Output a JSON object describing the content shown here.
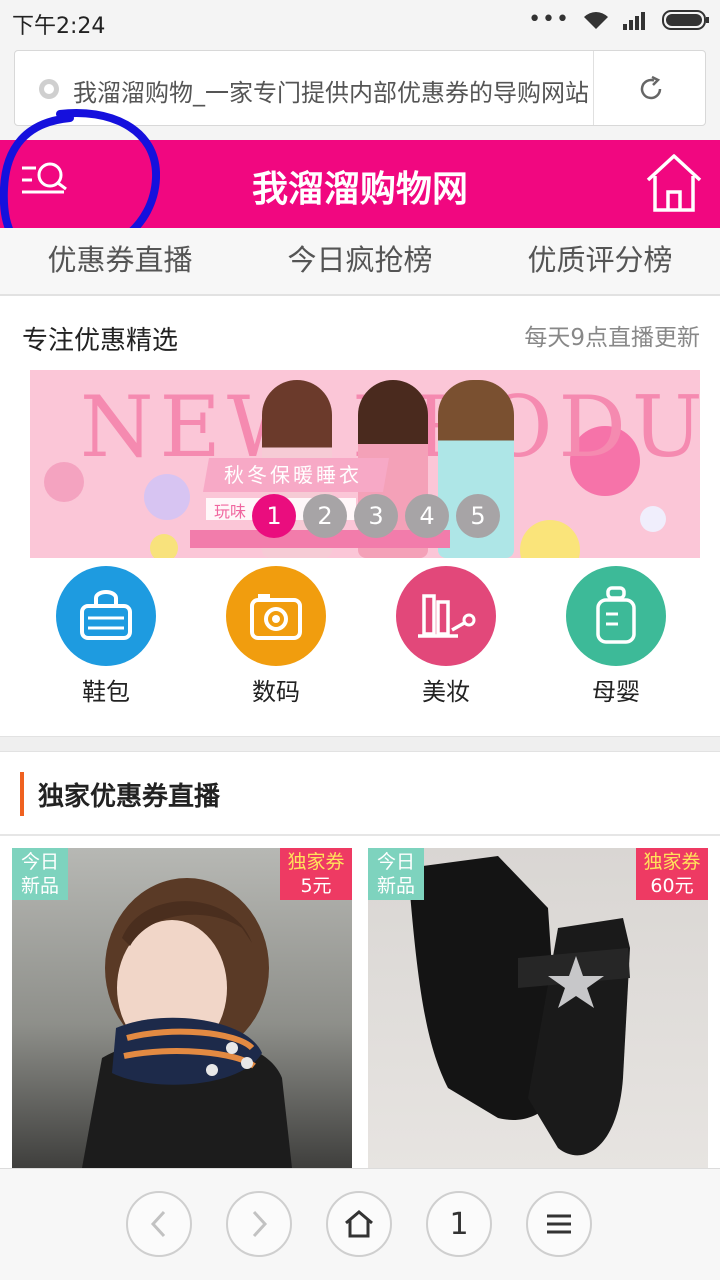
{
  "status_bar": {
    "time": "下午2:24",
    "more": "•••"
  },
  "address_bar": {
    "text": "我溜溜购物_一家专门提供内部优惠券的导购网站"
  },
  "header": {
    "title": "我溜溜购物网",
    "brand_color": "#f10780"
  },
  "tabs": [
    {
      "label": "优惠券直播"
    },
    {
      "label": "今日疯抢榜"
    },
    {
      "label": "优质评分榜"
    }
  ],
  "section": {
    "title": "专注优惠精选",
    "subtitle": "每天9点直播更新"
  },
  "banner": {
    "headline": "NEW PRODUCT",
    "caption": "秋冬保暖睡衣",
    "caption2": "玩味",
    "pager": [
      "1",
      "2",
      "3",
      "4",
      "5"
    ],
    "active_page": 1
  },
  "categories": [
    {
      "label": "鞋包",
      "icon": "basket-icon",
      "color": "#1e9be0"
    },
    {
      "label": "数码",
      "icon": "camera-icon",
      "color": "#f19d0e"
    },
    {
      "label": "美妆",
      "icon": "cosmetics-icon",
      "color": "#e2487a"
    },
    {
      "label": "母婴",
      "icon": "baby-bottle-icon",
      "color": "#3dba98"
    }
  ],
  "coupon_section": {
    "title": "独家优惠券直播",
    "accent": "#ef6120"
  },
  "products": [
    {
      "new_line1": "今日",
      "new_line2": "新品",
      "coupon_line1": "独家券",
      "coupon_line2": "5元"
    },
    {
      "new_line1": "今日",
      "new_line2": "新品",
      "coupon_line1": "独家券",
      "coupon_line2": "60元"
    }
  ],
  "bottom_nav": {
    "tab_count": "1"
  }
}
